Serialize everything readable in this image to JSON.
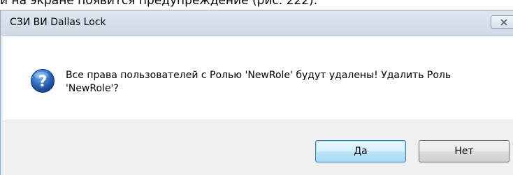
{
  "document": {
    "caption_text": "и на экране появится предупреждение (рис. 222):"
  },
  "dialog": {
    "title": "СЗИ ВИ Dallas Lock",
    "message": "Все права пользователей с Ролью 'NewRole' будут удалены! Удалить Роль 'NewRole'?",
    "icon": "question-icon",
    "buttons": {
      "yes_label": "Да",
      "no_label": "Нет"
    }
  },
  "colors": {
    "titlebar": "#d6e0eb",
    "icon_blue": "#2a63b5",
    "default_button_border": "#3c7fb1"
  }
}
